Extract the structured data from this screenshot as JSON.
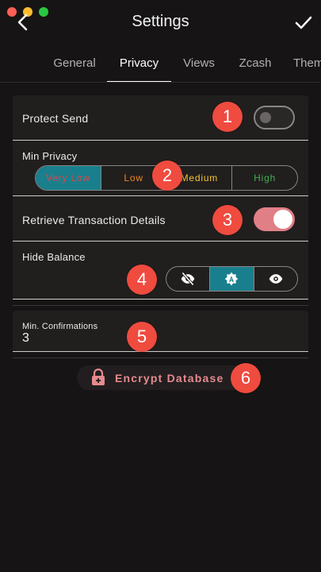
{
  "header": {
    "title": "Settings"
  },
  "tabs": [
    {
      "label": "General"
    },
    {
      "label": "Privacy"
    },
    {
      "label": "Views"
    },
    {
      "label": "Zcash"
    },
    {
      "label": "Them"
    }
  ],
  "active_tab": "Privacy",
  "settings": {
    "protect_send": {
      "label": "Protect Send",
      "enabled": false
    },
    "min_privacy": {
      "label": "Min Privacy",
      "options": [
        {
          "label": "Very Low",
          "color": "#e0444b"
        },
        {
          "label": "Low",
          "color": "#f08a1e"
        },
        {
          "label": "Medium",
          "color": "#f2c230"
        },
        {
          "label": "High",
          "color": "#3fb04f"
        }
      ],
      "selected": "Very Low"
    },
    "retrieve_tx": {
      "label": "Retrieve Transaction Details",
      "enabled": true
    },
    "hide_balance": {
      "label": "Hide Balance",
      "options": [
        {
          "icon": "eye-off-icon"
        },
        {
          "icon": "auto-icon"
        },
        {
          "icon": "eye-icon"
        }
      ],
      "selected": "auto-icon"
    },
    "min_confirmations": {
      "label": "Min. Confirmations",
      "value": "3"
    },
    "encrypt": {
      "label": "Encrypt Database",
      "icon": "lock-icon"
    }
  },
  "annotations": [
    "1",
    "2",
    "3",
    "4",
    "5",
    "6"
  ],
  "colors": {
    "accent": "#1a7f8c",
    "toggle_on": "#e07f86",
    "badge": "#ef4b3f",
    "encrypt_text": "#e58a8e"
  }
}
